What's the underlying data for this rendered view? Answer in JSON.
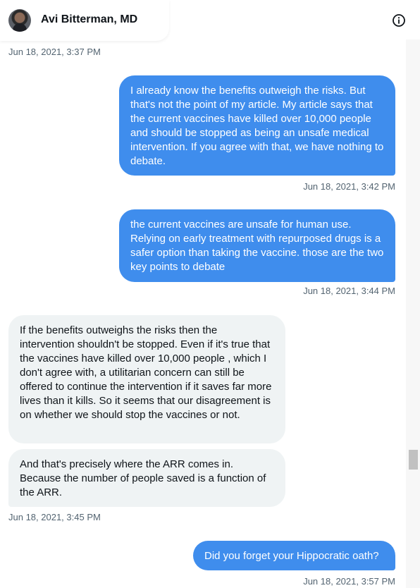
{
  "header": {
    "name": "Avi Bitterman, MD",
    "info_icon": "info-icon"
  },
  "messages": [
    {
      "timestamp": "Jun 18, 2021, 3:37 PM"
    },
    {
      "text": "I already know the benefits outweigh the risks. But that's not the point of my article. My article says that the current vaccines have killed over 10,000 people and should be stopped as being an unsafe medical intervention. If you agree with that, we have nothing to debate.",
      "timestamp": "Jun 18, 2021, 3:42 PM"
    },
    {
      "text": "the current vaccines are unsafe for human use. Relying on early treatment with repurposed drugs is a safer option than taking the vaccine. those are the two key points to debate",
      "timestamp": "Jun 18, 2021, 3:44 PM"
    },
    {
      "text": "If the benefits outweighs the risks then the intervention shouldn't be stopped. Even if it's true that the vaccines have killed over 10,000 people , which I don't agree with, a utilitarian concern can still be offered to continue the intervention if it saves far more lives than it kills. So it seems that our disagreement is on whether we should stop the vaccines or not."
    },
    {
      "text": "And that's precisely where the ARR comes in. Because the number of people saved is a function of the ARR.",
      "timestamp": "Jun 18, 2021, 3:45 PM"
    },
    {
      "text": "Did you forget your Hippocratic oath?",
      "timestamp": "Jun 18, 2021, 3:57 PM"
    }
  ]
}
